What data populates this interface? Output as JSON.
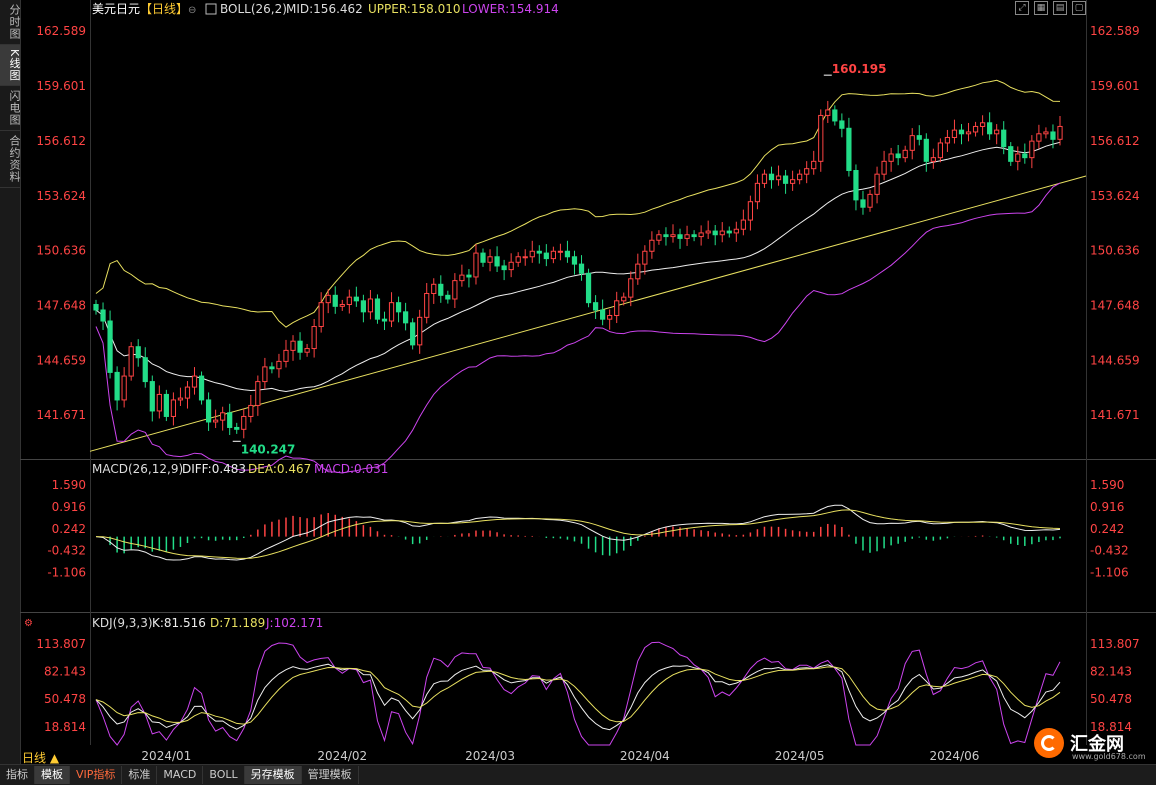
{
  "left_tabs": [
    "分时图",
    "K线图",
    "闪电图",
    "合约资料"
  ],
  "main": {
    "symbol": "美元日元",
    "period_tag": "【日线】",
    "indicator": "BOLL(26,2)",
    "mid": "MID:156.462",
    "upper": "UPPER:158.010",
    "lower": "LOWER:154.914",
    "y_ticks": [
      "162.589",
      "159.601",
      "156.612",
      "153.624",
      "150.636",
      "147.648",
      "144.659",
      "141.671"
    ],
    "y_range": [
      139.5,
      163.2
    ],
    "high_label": "160.195",
    "low_label": "140.247"
  },
  "macd": {
    "title": "MACD(26,12,9)",
    "diff": "DIFF:0.483",
    "dea": "DEA:0.467",
    "macd": "MACD:0.031",
    "y_ticks": [
      "1.590",
      "0.916",
      "0.242",
      "-0.432",
      "-1.106"
    ],
    "y_range": [
      -1.65,
      1.75
    ]
  },
  "kdj": {
    "title": "KDJ(9,3,3)",
    "k": "K:81.516",
    "d": "D:71.189",
    "j": "J:102.171",
    "y_ticks": [
      "113.807",
      "82.143",
      "50.478",
      "18.814"
    ],
    "y_range": [
      -2,
      125
    ]
  },
  "x_labels": [
    "2024/01",
    "2024/02",
    "2024/03",
    "2024/04",
    "2024/05",
    "2024/06"
  ],
  "bottom_period": "日线",
  "bottom_tabs": [
    "指标",
    "模板",
    "VIP指标",
    "标准",
    "MACD",
    "BOLL",
    "另存模板",
    "管理模板"
  ],
  "logo": {
    "name": "汇金网",
    "url": "www.gold678.com"
  },
  "colors": {
    "up": "#ff4444",
    "down": "#22dd88",
    "upper": "#e8e060",
    "mid": "#eeeeee",
    "lower": "#cc44ee",
    "axis_text": "#ff4444",
    "trend": "#e8e060"
  },
  "chart_data": [
    {
      "type": "candlestick",
      "title": "美元日元【日线】",
      "x_labels": [
        "2024/01",
        "2024/02",
        "2024/03",
        "2024/04",
        "2024/05",
        "2024/06"
      ],
      "ylim": [
        139.5,
        163.2
      ],
      "annotations": [
        {
          "text": "160.195",
          "value": 160.195
        },
        {
          "text": "140.247",
          "value": 140.247
        }
      ],
      "closes": [
        147.4,
        146.8,
        144.0,
        142.5,
        143.8,
        145.4,
        144.8,
        143.5,
        141.9,
        142.8,
        141.6,
        142.5,
        142.6,
        143.2,
        143.8,
        142.5,
        141.3,
        141.4,
        141.8,
        141.0,
        140.9,
        141.6,
        142.2,
        143.5,
        144.3,
        144.2,
        144.6,
        145.2,
        145.7,
        145.1,
        145.3,
        146.5,
        147.8,
        148.2,
        147.6,
        147.7,
        148.1,
        147.9,
        147.3,
        148.0,
        146.9,
        146.8,
        147.8,
        147.3,
        146.7,
        145.5,
        147.0,
        148.3,
        148.8,
        148.2,
        148.0,
        149.0,
        149.3,
        149.2,
        150.5,
        150.0,
        150.3,
        149.8,
        149.6,
        150.0,
        150.3,
        150.3,
        150.6,
        150.5,
        150.2,
        150.6,
        150.6,
        150.3,
        149.9,
        149.4,
        147.8,
        147.4,
        146.9,
        147.1,
        147.9,
        148.1,
        149.1,
        149.9,
        150.6,
        151.2,
        151.5,
        151.4,
        151.5,
        151.3,
        151.5,
        151.4,
        151.6,
        151.7,
        151.5,
        151.7,
        151.6,
        151.8,
        152.3,
        153.3,
        154.3,
        154.8,
        154.5,
        154.7,
        154.3,
        154.5,
        154.8,
        155.1,
        155.5,
        158.0,
        158.3,
        157.7,
        157.3,
        155.0,
        153.4,
        153.0,
        153.7,
        154.8,
        155.5,
        155.9,
        155.7,
        156.1,
        156.9,
        156.7,
        155.5,
        155.7,
        156.5,
        156.8,
        157.2,
        157.0,
        157.1,
        157.4,
        157.6,
        157.0,
        157.2,
        156.3,
        155.5,
        155.9,
        155.7,
        156.6,
        157.0,
        157.1,
        156.7,
        157.4
      ]
    },
    {
      "type": "macd",
      "title": "MACD(26,12,9)",
      "ylim": [
        -1.65,
        1.75
      ],
      "values": {
        "DIFF": 0.483,
        "DEA": 0.467,
        "MACD": 0.031
      }
    },
    {
      "type": "kdj",
      "title": "KDJ(9,3,3)",
      "ylim": [
        -2,
        125
      ],
      "values": {
        "K": 81.516,
        "D": 71.189,
        "J": 102.171
      }
    }
  ]
}
